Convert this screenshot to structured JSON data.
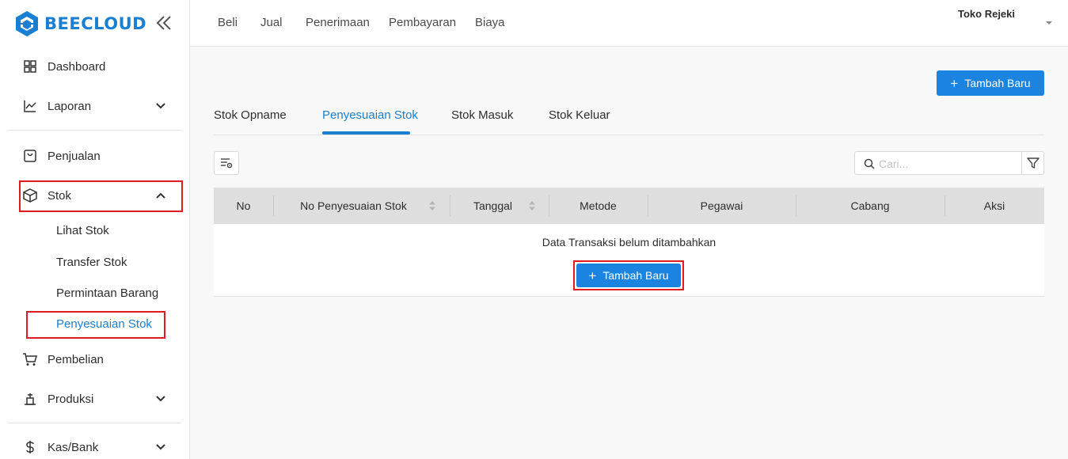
{
  "brand": {
    "name": "BEECLOUD",
    "color": "#1a7ed1"
  },
  "sidebar": {
    "items": [
      {
        "label": "Dashboard",
        "icon": "dashboard-grid-icon"
      },
      {
        "label": "Laporan",
        "icon": "chart-line-icon",
        "expandable": true,
        "expanded": false
      },
      {
        "label": "Penjualan",
        "icon": "bag-icon"
      },
      {
        "label": "Stok",
        "icon": "box-icon",
        "expandable": true,
        "expanded": true
      },
      {
        "label": "Pembelian",
        "icon": "cart-icon"
      },
      {
        "label": "Produksi",
        "icon": "production-icon",
        "expandable": true,
        "expanded": false
      },
      {
        "label": "Kas/Bank",
        "icon": "dollar-icon",
        "expandable": true,
        "expanded": false
      }
    ],
    "stok_sub": [
      {
        "label": "Lihat Stok",
        "active": false
      },
      {
        "label": "Transfer Stok",
        "active": false
      },
      {
        "label": "Permintaan Barang",
        "active": false
      },
      {
        "label": "Penyesuaian Stok",
        "active": true
      }
    ]
  },
  "topbar": {
    "links": [
      "Beli",
      "Jual",
      "Penerimaan",
      "Pembayaran",
      "Biaya"
    ],
    "store": "Toko Rejeki"
  },
  "main": {
    "add_button": "Tambah Baru",
    "tabs": [
      {
        "label": "Stok Opname",
        "active": false
      },
      {
        "label": "Penyesuaian Stok",
        "active": true
      },
      {
        "label": "Stok Masuk",
        "active": false
      },
      {
        "label": "Stok Keluar",
        "active": false
      }
    ],
    "search": {
      "placeholder": "Cari...",
      "value": ""
    },
    "table": {
      "columns": [
        "No",
        "No Penyesuaian Stok",
        "Tanggal",
        "Metode",
        "Pegawai",
        "Cabang",
        "Aksi"
      ],
      "empty_text": "Data Transaksi belum ditambahkan",
      "empty_button": "Tambah Baru"
    }
  },
  "colors": {
    "primary": "#1a84e0",
    "highlight": "#e01b22",
    "table_header": "#dedede"
  }
}
